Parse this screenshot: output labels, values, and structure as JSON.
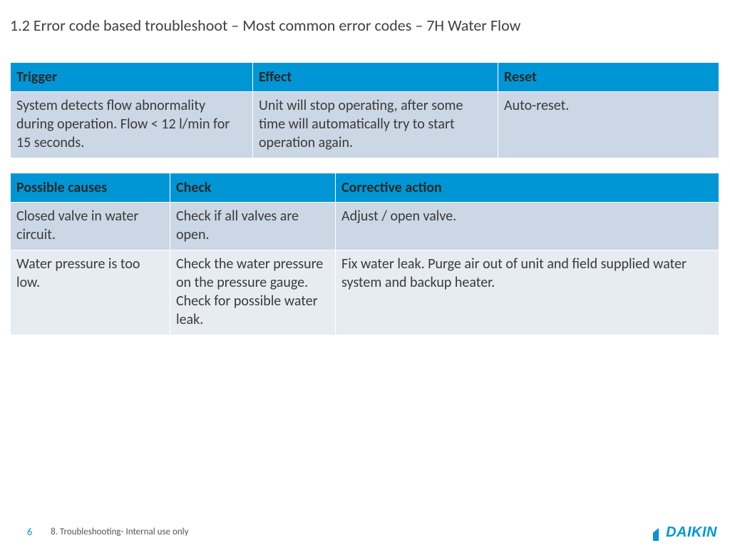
{
  "title": "1.2 Error code based troubleshoot –  Most common error codes – 7H Water Flow",
  "table1": {
    "headers": [
      "Trigger",
      "Effect",
      "Reset"
    ],
    "row": [
      "System detects flow abnormality during operation. Flow < 12 l/min for 15 seconds.",
      "Unit will stop operating, after some time\nwill automatically try to start operation\nagain.",
      "Auto-reset."
    ]
  },
  "table2": {
    "headers": [
      "Possible causes",
      "Check",
      "Corrective action"
    ],
    "rows": [
      [
        "Closed valve in water circuit.",
        "Check if all valves are open.",
        "Adjust / open valve."
      ],
      [
        "Water pressure is too low.",
        "Check the water pressure on the pressure\ngauge.\nCheck for possible water leak.",
        "Fix water leak.\nPurge air out of unit and field supplied water system and backup heater."
      ]
    ]
  },
  "footer": {
    "page": "6",
    "note": "8. Troubleshooting- Internal use only",
    "brand": "DAIKIN"
  }
}
